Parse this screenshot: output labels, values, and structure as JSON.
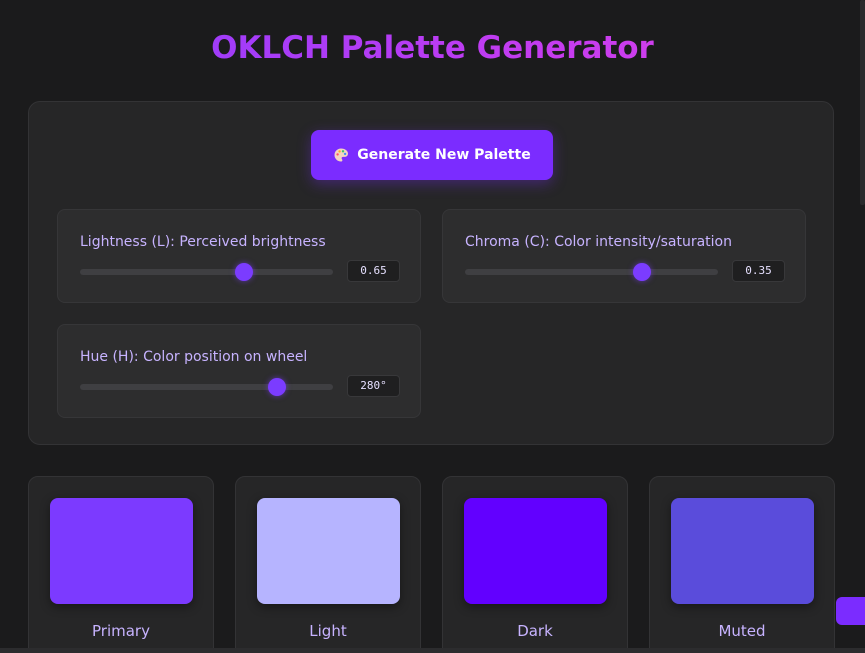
{
  "header": {
    "title": "OKLCH Palette Generator"
  },
  "controls": {
    "generate_label": "Generate New Palette",
    "generate_icon": "palette-icon",
    "sliders": [
      {
        "key": "lightness",
        "label": "Lightness (L): Perceived brightness",
        "value_text": "0.65",
        "value": 0.65,
        "min": 0,
        "max": 1
      },
      {
        "key": "chroma",
        "label": "Chroma (C): Color intensity/saturation",
        "value_text": "0.35",
        "value": 0.35,
        "min": 0,
        "max": 0.5
      },
      {
        "key": "hue",
        "label": "Hue (H): Color position on wheel",
        "value_text": "280°",
        "value": 280,
        "min": 0,
        "max": 360
      }
    ]
  },
  "palette": {
    "swatches": [
      {
        "name": "Primary",
        "color": "#7c3aff"
      },
      {
        "name": "Light",
        "color": "#b6b4ff"
      },
      {
        "name": "Dark",
        "color": "#6200ff"
      },
      {
        "name": "Muted",
        "color": "#5a4cdb"
      }
    ]
  },
  "theme": {
    "accent": "#7b2cff",
    "background": "#1b1b1c",
    "panel": "#262627"
  }
}
